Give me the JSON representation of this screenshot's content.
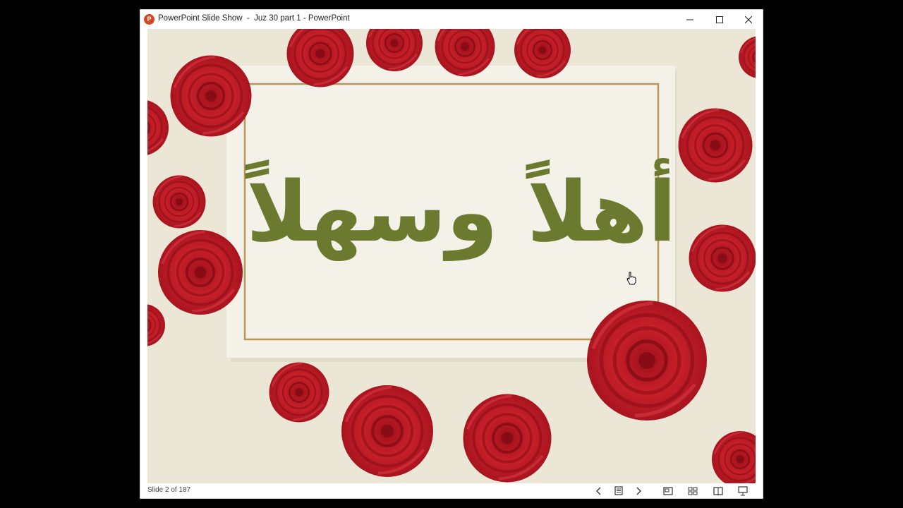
{
  "window": {
    "title": "PowerPoint Slide Show  -  Juz 30 part 1 - PowerPoint",
    "app_icon_letter": "P",
    "controls": {
      "minimize": "minimize-icon",
      "maximize": "maximize-icon",
      "close": "close-icon"
    }
  },
  "slide": {
    "greeting_text": "أهلاً وسهلاً",
    "colors": {
      "rose": "#c8202a",
      "card": "#f4f1e8",
      "frame": "#b8955a",
      "calligraphy": "#6b7a2e",
      "background": "#ece6d6"
    }
  },
  "statusbar": {
    "slide_counter": "Slide 2 of 187",
    "icons": [
      "previous-icon",
      "notes-icon",
      "next-icon",
      "normal-view-icon",
      "slide-sorter-icon",
      "reading-view-icon",
      "slide-show-icon"
    ]
  }
}
